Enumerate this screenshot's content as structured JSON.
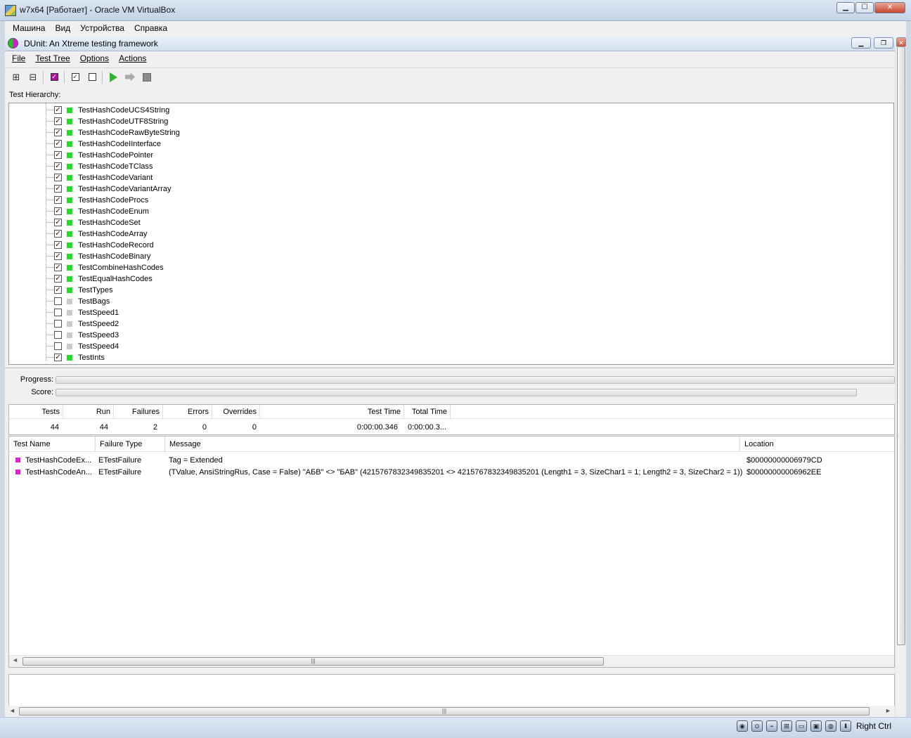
{
  "vbox": {
    "title": "w7x64 [Работает] - Oracle VM VirtualBox",
    "menu": [
      "Машина",
      "Вид",
      "Устройства",
      "Справка"
    ],
    "status_right": "Right Ctrl"
  },
  "dunit": {
    "title": "DUnit: An Xtreme testing framework",
    "menu": [
      "File",
      "Test Tree",
      "Options",
      "Actions"
    ],
    "hierarchy_label": "Test Hierarchy:",
    "tree": [
      {
        "name": "TestHashCodeUCS4String",
        "checked": true,
        "status": "pass"
      },
      {
        "name": "TestHashCodeUTF8String",
        "checked": true,
        "status": "pass"
      },
      {
        "name": "TestHashCodeRawByteString",
        "checked": true,
        "status": "pass"
      },
      {
        "name": "TestHashCodeIInterface",
        "checked": true,
        "status": "pass"
      },
      {
        "name": "TestHashCodePointer",
        "checked": true,
        "status": "pass"
      },
      {
        "name": "TestHashCodeTClass",
        "checked": true,
        "status": "pass"
      },
      {
        "name": "TestHashCodeVariant",
        "checked": true,
        "status": "pass"
      },
      {
        "name": "TestHashCodeVariantArray",
        "checked": true,
        "status": "pass"
      },
      {
        "name": "TestHashCodeProcs",
        "checked": true,
        "status": "pass"
      },
      {
        "name": "TestHashCodeEnum",
        "checked": true,
        "status": "pass"
      },
      {
        "name": "TestHashCodeSet",
        "checked": true,
        "status": "pass"
      },
      {
        "name": "TestHashCodeArray",
        "checked": true,
        "status": "pass"
      },
      {
        "name": "TestHashCodeRecord",
        "checked": true,
        "status": "pass"
      },
      {
        "name": "TestHashCodeBinary",
        "checked": true,
        "status": "pass"
      },
      {
        "name": "TestCombineHashCodes",
        "checked": true,
        "status": "pass"
      },
      {
        "name": "TestEqualHashCodes",
        "checked": true,
        "status": "pass"
      },
      {
        "name": "TestTypes",
        "checked": true,
        "status": "pass"
      },
      {
        "name": "TestBags",
        "checked": false,
        "status": "skipped"
      },
      {
        "name": "TestSpeed1",
        "checked": false,
        "status": "skipped"
      },
      {
        "name": "TestSpeed2",
        "checked": false,
        "status": "skipped"
      },
      {
        "name": "TestSpeed3",
        "checked": false,
        "status": "skipped"
      },
      {
        "name": "TestSpeed4",
        "checked": false,
        "status": "skipped"
      },
      {
        "name": "TestInts",
        "checked": true,
        "status": "pass"
      }
    ],
    "progress_label": "Progress:",
    "score_label": "Score:",
    "stats": {
      "headers": [
        "Tests",
        "Run",
        "Failures",
        "Errors",
        "Overrides",
        "Test Time",
        "Total Time"
      ],
      "values": [
        "44",
        "44",
        "2",
        "0",
        "0",
        "0:00:00.346",
        "0:00:00.3..."
      ]
    },
    "results": {
      "headers": [
        "Test Name",
        "Failure Type",
        "Message",
        "Location"
      ],
      "rows": [
        [
          "TestHashCodeEx...",
          "ETestFailure",
          "Tag = Extended",
          "$00000000006979CD"
        ],
        [
          "TestHashCodeAn...",
          "ETestFailure",
          "(TValue, AnsiStringRus, Case = False) \"АБВ\" <> \"БАВ\" (4215767832349835201 <> 4215767832349835201 (Length1 = 3, SizeChar1 = 1; Length2 = 3, SizeChar2 = 1))",
          "$00000000006962EE"
        ]
      ]
    }
  },
  "colors": {
    "pass": "#22dd22",
    "skipped": "#c8c8c8",
    "failure": "#e021d8"
  }
}
